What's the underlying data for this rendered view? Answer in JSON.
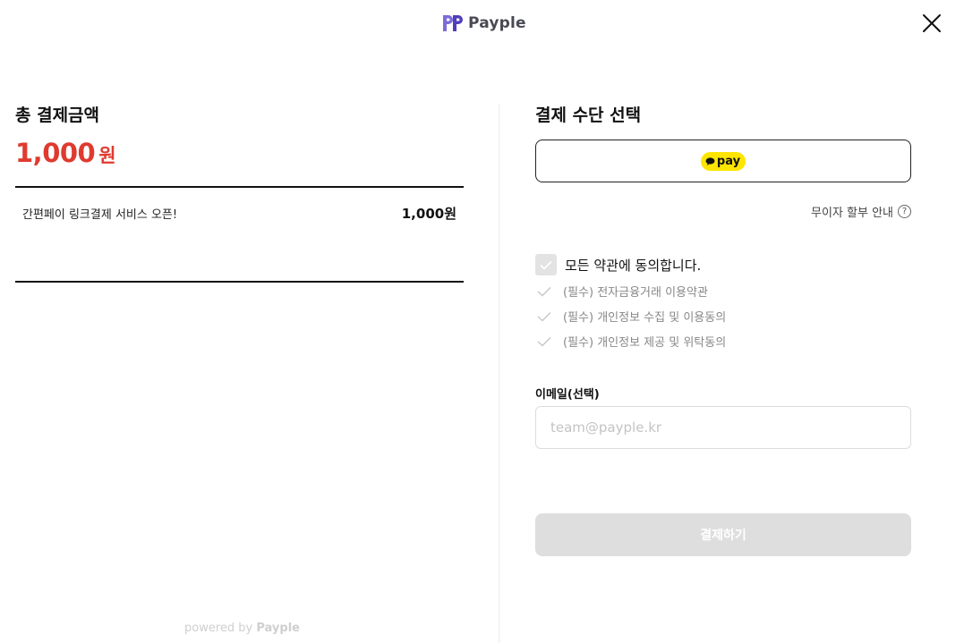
{
  "header": {
    "brand": "Payple",
    "close_icon": "close-icon",
    "logo_icon": "payple-logo-icon"
  },
  "order": {
    "total_label": "총 결제금액",
    "total_amount": "1,000",
    "total_unit": "원",
    "items": [
      {
        "name": "간편페이 링크결제 서비스 오픈!",
        "price": "1,000원"
      }
    ],
    "powered_prefix": "powered by",
    "powered_brand": "Payple"
  },
  "payment": {
    "title": "결제 수단 선택",
    "method": {
      "label": "pay",
      "icon": "kakao-bubble-icon"
    },
    "installment_label": "무이자 할부 안내",
    "installment_icon": "question-circle-icon"
  },
  "terms": {
    "agree_all": "모든 약관에 동의합니다.",
    "items": [
      "(필수) 전자금융거래 이용약관",
      "(필수) 개인정보 수집 및 이용동의",
      "(필수) 개인정보 제공 및 위탁동의"
    ]
  },
  "email": {
    "label": "이메일(선택)",
    "placeholder": "team@payple.kr",
    "value": ""
  },
  "submit": {
    "label": "결제하기"
  },
  "colors": {
    "accent_red": "#e03a2f",
    "brand_purple": "#6b5bd2",
    "kakao_yellow": "#fee500",
    "disabled_button": "#dedede"
  }
}
